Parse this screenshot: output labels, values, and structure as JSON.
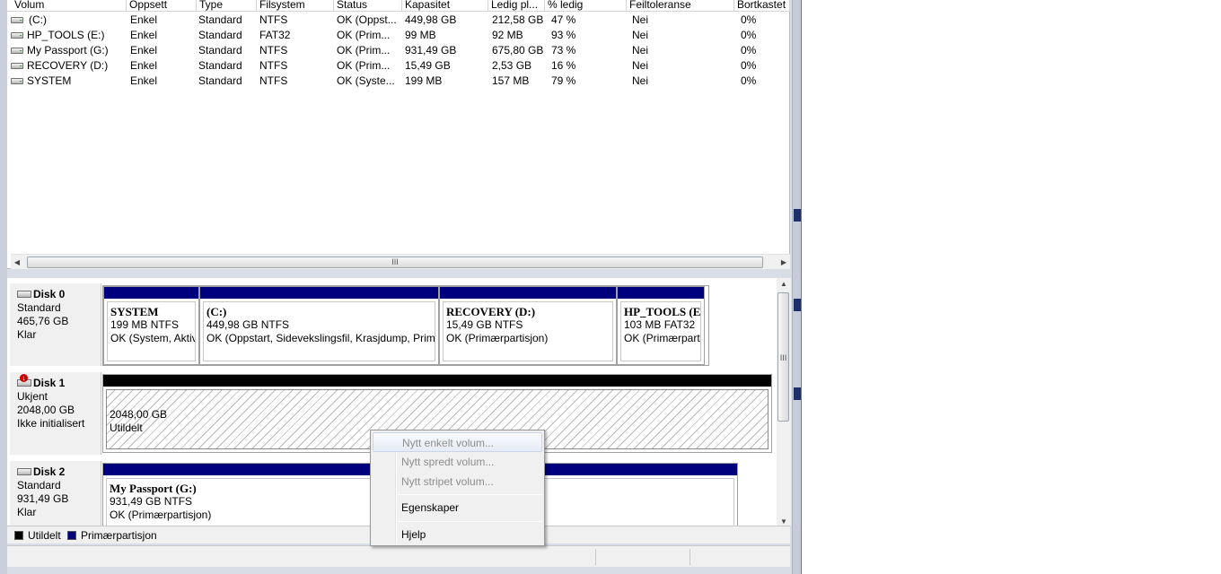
{
  "columns": [
    "Volum",
    "Oppsett",
    "Type",
    "Filsystem",
    "Status",
    "Kapasitet",
    "Ledig pl...",
    "% ledig",
    "Feiltoleranse",
    "Bortkastet"
  ],
  "volumes": [
    {
      "name": "(C:)",
      "layout": "Enkel",
      "type": "Standard",
      "fs": "NTFS",
      "status": "OK (Oppst...",
      "capacity": "449,98 GB",
      "free": "212,58 GB",
      "pct": "47 %",
      "fault": "Nei",
      "overhead": "0%"
    },
    {
      "name": "HP_TOOLS (E:)",
      "layout": "Enkel",
      "type": "Standard",
      "fs": "FAT32",
      "status": "OK (Prim...",
      "capacity": "99 MB",
      "free": "92 MB",
      "pct": "93 %",
      "fault": "Nei",
      "overhead": "0%"
    },
    {
      "name": "My Passport (G:)",
      "layout": "Enkel",
      "type": "Standard",
      "fs": "NTFS",
      "status": "OK (Prim...",
      "capacity": "931,49 GB",
      "free": "675,80 GB",
      "pct": "73 %",
      "fault": "Nei",
      "overhead": "0%"
    },
    {
      "name": "RECOVERY (D:)",
      "layout": "Enkel",
      "type": "Standard",
      "fs": "NTFS",
      "status": "OK (Prim...",
      "capacity": "15,49 GB",
      "free": "2,53 GB",
      "pct": "16 %",
      "fault": "Nei",
      "overhead": "0%"
    },
    {
      "name": "SYSTEM",
      "layout": "Enkel",
      "type": "Standard",
      "fs": "NTFS",
      "status": "OK (Syste...",
      "capacity": "199 MB",
      "free": "157 MB",
      "pct": "79 %",
      "fault": "Nei",
      "overhead": "0%"
    }
  ],
  "disks": [
    {
      "title": "Disk 0",
      "type": "Standard",
      "size": "465,76 GB",
      "state": "Klar",
      "partitions": [
        {
          "name": "SYSTEM",
          "size": "199 MB NTFS",
          "status": "OK (System, Aktiv"
        },
        {
          "name": " (C:)",
          "size": "449,98 GB NTFS",
          "status": "OK (Oppstart, Sidevekslingsfil, Krasjdump, Prim"
        },
        {
          "name": "RECOVERY  (D:)",
          "size": "15,49 GB NTFS",
          "status": "OK (Primærpartisjon)"
        },
        {
          "name": "HP_TOOLS  (E:)",
          "size": "103 MB FAT32",
          "status": "OK (Primærpart"
        }
      ]
    },
    {
      "title": "Disk 1",
      "type": "Ukjent",
      "size": "2048,00 GB",
      "state": "Ikke initialisert",
      "partitions": [
        {
          "name": "",
          "size": "2048,00 GB",
          "status": "Utildelt"
        }
      ]
    },
    {
      "title": "Disk 2",
      "type": "Standard",
      "size": "931,49 GB",
      "state": "Klar",
      "partitions": [
        {
          "name": "My Passport  (G:)",
          "size": "931,49 GB NTFS",
          "status": "OK (Primærpartisjon)"
        }
      ]
    }
  ],
  "legend": {
    "unallocated": "Utildelt",
    "primary": "Primærpartisjon"
  },
  "scroll_glyph": "III",
  "context_menu": {
    "items": [
      {
        "label": "Nytt enkelt volum...",
        "enabled": false
      },
      {
        "label": "Nytt spredt volum...",
        "enabled": false
      },
      {
        "label": "Nytt stripet volum...",
        "enabled": false
      },
      {
        "label": "Egenskaper",
        "enabled": true
      },
      {
        "label": "Hjelp",
        "enabled": true
      }
    ]
  },
  "colors": {
    "primary_partition": "#00007f",
    "unallocated": "#000000",
    "menu_disabled": "#8d8d8d"
  }
}
